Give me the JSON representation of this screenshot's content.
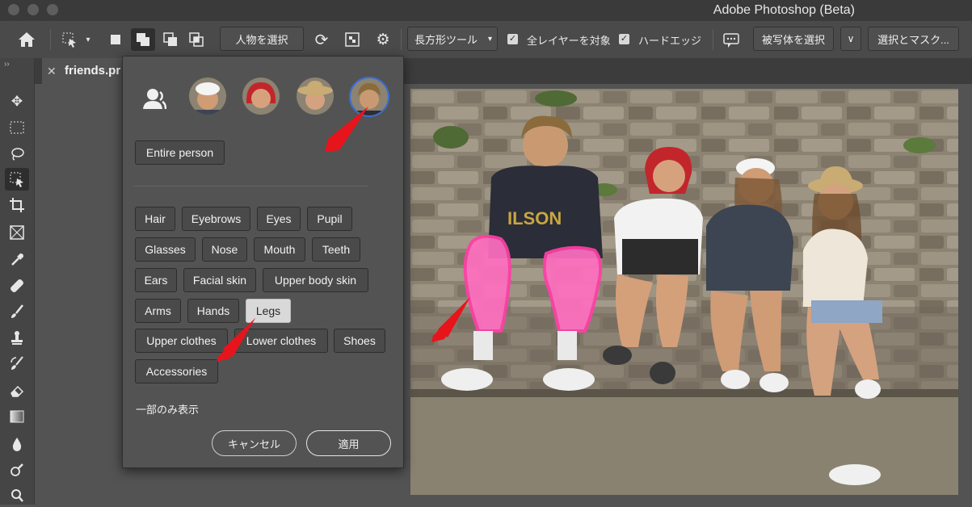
{
  "window": {
    "title": "Adobe Photoshop (Beta)"
  },
  "options_bar": {
    "subject_select_label": "人物を選択",
    "marquee_dropdown_label": "長方形ツール",
    "sample_all_layers_label": "全レイヤーを対象",
    "hard_edge_label": "ハードエッジ",
    "select_subject_label": "被写体を選択",
    "select_and_mask_label": "選択とマスク..."
  },
  "document": {
    "tab_title": "friends.pr"
  },
  "people_panel": {
    "entire_person_label": "Entire person",
    "parts": [
      {
        "label": "Hair",
        "selected": false
      },
      {
        "label": "Eyebrows",
        "selected": false
      },
      {
        "label": "Eyes",
        "selected": false
      },
      {
        "label": "Pupil",
        "selected": false
      },
      {
        "label": "Glasses",
        "selected": false
      },
      {
        "label": "Nose",
        "selected": false
      },
      {
        "label": "Mouth",
        "selected": false
      },
      {
        "label": "Teeth",
        "selected": false
      },
      {
        "label": "Ears",
        "selected": false
      },
      {
        "label": "Facial skin",
        "selected": false
      },
      {
        "label": "Upper body skin",
        "selected": false
      },
      {
        "label": "Arms",
        "selected": false
      },
      {
        "label": "Hands",
        "selected": false
      },
      {
        "label": "Legs",
        "selected": true
      },
      {
        "label": "Upper clothes",
        "selected": false
      },
      {
        "label": "Lower clothes",
        "selected": false
      },
      {
        "label": "Shoes",
        "selected": false
      },
      {
        "label": "Accessories",
        "selected": false
      }
    ],
    "show_partial_label": "一部のみ表示",
    "cancel_label": "キャンセル",
    "apply_label": "適用"
  },
  "colors": {
    "annotation_arrow": "#e8141c",
    "leg_highlight": "#ff6fc0",
    "selected_avatar_ring": "#3b6fd8"
  }
}
